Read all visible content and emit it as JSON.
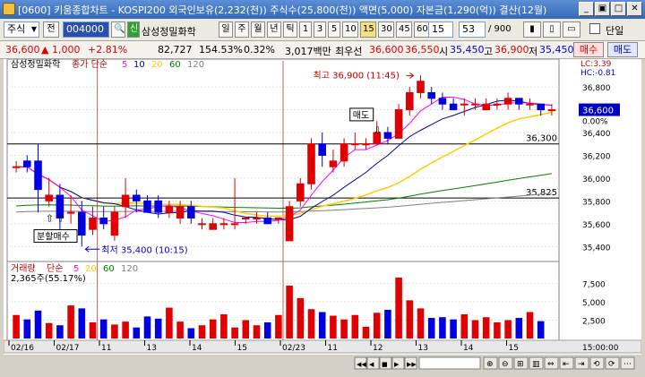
{
  "titlebar": {
    "title": "[0600] 키움종합차트 - KOSPI200 외국인보유(2,232(천)) 주식수(25,800(천)) 액면(5,000) 자본금(1,290(억)) 결산(12월)",
    "minimize": "_",
    "maximize": "□",
    "restore": "▣",
    "close": "✕"
  },
  "toolbar1": {
    "market_type": "주식",
    "prev_label": "전",
    "code": "004000",
    "stock_name": "삼성정밀화학",
    "period_buttons": [
      "일",
      "주",
      "월",
      "년",
      "틱",
      "1",
      "3",
      "5",
      "10",
      "15",
      "30",
      "45",
      "60"
    ],
    "active_period": "15",
    "interval_value": "15",
    "count_value": "53",
    "count_total": "/ 900",
    "single_label": "단일"
  },
  "toolbar2": {
    "price": "36,600",
    "change": "▲ 1,000",
    "change_rate": "+2.81%",
    "volume": "82,727",
    "volume_rate": "154.53%",
    "turnover_rate": "0.32%",
    "amount": "3,017백만",
    "bid_label": "최우선",
    "ask_price": "36,600",
    "bid_price": "36,550",
    "high_label": "시",
    "open": "35,450",
    "high_label2": "고",
    "high": "36,900",
    "low_label": "저",
    "low": "35,450",
    "buy_button": "매수",
    "sell_button": "매도"
  },
  "price_panel": {
    "legend_name": "삼성정밀화학",
    "legend_ma": "종가 단순",
    "ma_periods": [
      "5",
      "10",
      "20",
      "60",
      "120"
    ],
    "lc": "LC:3.39",
    "hc": "HC:-0.81",
    "current_price_tag": "36,600",
    "pct_label": "0.00%",
    "level_36300": "36,300",
    "level_35825": "35,825",
    "high_annotation": "최고 36,900 (11:45)",
    "low_annotation": "최저 35,400 (10:15)",
    "split_buy_label": "분할매수",
    "sell_label": "매도"
  },
  "volume_panel": {
    "legend_name": "거래량",
    "legend_ma": "단순",
    "ma_periods": [
      "5",
      "20",
      "60",
      "120"
    ],
    "current": "2,365주(55.17%)"
  },
  "x_axis": {
    "labels": [
      "02/16",
      "02/17",
      "11",
      "13",
      "14",
      "15",
      "02/23",
      "11",
      "12",
      "13",
      "14",
      "15"
    ],
    "time_label": "15:00:00"
  },
  "colors": {
    "up": "#e00000",
    "down": "#0000e0",
    "ma5": "#ff00ff",
    "ma10": "#0000a0",
    "ma20": "#ffcc00",
    "ma60": "#008000",
    "ma120": "#808080"
  },
  "chart_data": {
    "type": "candlestick",
    "ylim": [
      35300,
      36950
    ],
    "y_ticks": [
      35400,
      35600,
      35800,
      36000,
      36200,
      36400,
      36600,
      36800
    ],
    "y_tick_labels": [
      "35,400",
      "35,600",
      "35,800",
      "36,000",
      "36,200",
      "36,400",
      "36,600",
      "36,800"
    ],
    "candles": [
      {
        "o": 36100,
        "h": 36150,
        "l": 36050,
        "c": 36100
      },
      {
        "o": 36150,
        "h": 36200,
        "l": 36050,
        "c": 36100
      },
      {
        "o": 36150,
        "h": 36300,
        "l": 35700,
        "c": 35900
      },
      {
        "o": 35800,
        "h": 36000,
        "l": 35750,
        "c": 35850
      },
      {
        "o": 35850,
        "h": 35950,
        "l": 35550,
        "c": 35650
      },
      {
        "o": 35700,
        "h": 35850,
        "l": 35600,
        "c": 35700
      },
      {
        "o": 35700,
        "h": 35800,
        "l": 35400,
        "c": 35500
      },
      {
        "o": 35550,
        "h": 35750,
        "l": 35500,
        "c": 35650
      },
      {
        "o": 35650,
        "h": 35750,
        "l": 35550,
        "c": 35600
      },
      {
        "o": 35500,
        "h": 35750,
        "l": 35450,
        "c": 35700
      },
      {
        "o": 35750,
        "h": 36000,
        "l": 35650,
        "c": 35850
      },
      {
        "o": 35850,
        "h": 35900,
        "l": 35700,
        "c": 35800
      },
      {
        "o": 35800,
        "h": 35850,
        "l": 35700,
        "c": 35700
      },
      {
        "o": 35800,
        "h": 35850,
        "l": 35650,
        "c": 35700
      },
      {
        "o": 35700,
        "h": 35800,
        "l": 35650,
        "c": 35750
      },
      {
        "o": 35650,
        "h": 35800,
        "l": 35600,
        "c": 35750
      },
      {
        "o": 35750,
        "h": 35800,
        "l": 35600,
        "c": 35650
      },
      {
        "o": 35600,
        "h": 35650,
        "l": 35550,
        "c": 35600
      },
      {
        "o": 35550,
        "h": 35650,
        "l": 35550,
        "c": 35600
      },
      {
        "o": 35600,
        "h": 35650,
        "l": 35550,
        "c": 35600
      },
      {
        "o": 35600,
        "h": 36000,
        "l": 35550,
        "c": 35600
      },
      {
        "o": 35650,
        "h": 35650,
        "l": 35600,
        "c": 35650
      },
      {
        "o": 35650,
        "h": 35700,
        "l": 35600,
        "c": 35650
      },
      {
        "o": 35650,
        "h": 35700,
        "l": 35600,
        "c": 35600
      },
      {
        "o": 35650,
        "h": 35650,
        "l": 35600,
        "c": 35650
      },
      {
        "o": 35450,
        "h": 35800,
        "l": 35450,
        "c": 35750
      },
      {
        "o": 35800,
        "h": 36000,
        "l": 35750,
        "c": 35950
      },
      {
        "o": 35950,
        "h": 36350,
        "l": 35900,
        "c": 36300
      },
      {
        "o": 36300,
        "h": 36400,
        "l": 36100,
        "c": 36200
      },
      {
        "o": 36100,
        "h": 36250,
        "l": 36050,
        "c": 36150
      },
      {
        "o": 36150,
        "h": 36350,
        "l": 36100,
        "c": 36300
      },
      {
        "o": 36300,
        "h": 36400,
        "l": 36250,
        "c": 36300
      },
      {
        "o": 36300,
        "h": 36350,
        "l": 36250,
        "c": 36300
      },
      {
        "o": 36300,
        "h": 36500,
        "l": 36300,
        "c": 36400
      },
      {
        "o": 36400,
        "h": 36450,
        "l": 36300,
        "c": 36350
      },
      {
        "o": 36350,
        "h": 36650,
        "l": 36350,
        "c": 36600
      },
      {
        "o": 36600,
        "h": 36800,
        "l": 36550,
        "c": 36750
      },
      {
        "o": 36750,
        "h": 36900,
        "l": 36700,
        "c": 36850
      },
      {
        "o": 36750,
        "h": 36800,
        "l": 36650,
        "c": 36700
      },
      {
        "o": 36700,
        "h": 36750,
        "l": 36600,
        "c": 36650
      },
      {
        "o": 36650,
        "h": 36700,
        "l": 36600,
        "c": 36600
      },
      {
        "o": 36650,
        "h": 36700,
        "l": 36550,
        "c": 36650
      },
      {
        "o": 36650,
        "h": 36700,
        "l": 36600,
        "c": 36650
      },
      {
        "o": 36600,
        "h": 36700,
        "l": 36600,
        "c": 36650
      },
      {
        "o": 36650,
        "h": 36700,
        "l": 36600,
        "c": 36650
      },
      {
        "o": 36650,
        "h": 36750,
        "l": 36600,
        "c": 36700
      },
      {
        "o": 36700,
        "h": 36700,
        "l": 36600,
        "c": 36650
      },
      {
        "o": 36650,
        "h": 36700,
        "l": 36600,
        "c": 36650
      },
      {
        "o": 36650,
        "h": 36650,
        "l": 36550,
        "c": 36600
      },
      {
        "o": 36600,
        "h": 36650,
        "l": 36550,
        "c": 36600
      }
    ],
    "volume_ylim": [
      0,
      10000
    ],
    "volume_ticks": [
      2500,
      5000,
      7500
    ],
    "volume_tick_labels": [
      "2,500",
      "5,000",
      "7,500"
    ],
    "volumes": [
      3200,
      2600,
      3800,
      2100,
      1800,
      4500,
      4100,
      2200,
      2600,
      1900,
      2300,
      1500,
      3000,
      2700,
      4200,
      2300,
      1400,
      1800,
      2600,
      3300,
      1500,
      2500,
      1800,
      2200,
      3200,
      7200,
      5500,
      4000,
      3600,
      3100,
      2600,
      3200,
      1600,
      3500,
      3900,
      8300,
      5200,
      4100,
      2800,
      2900,
      2600,
      3300,
      2500,
      2900,
      2200,
      2500,
      2800,
      3600,
      2365
    ]
  }
}
